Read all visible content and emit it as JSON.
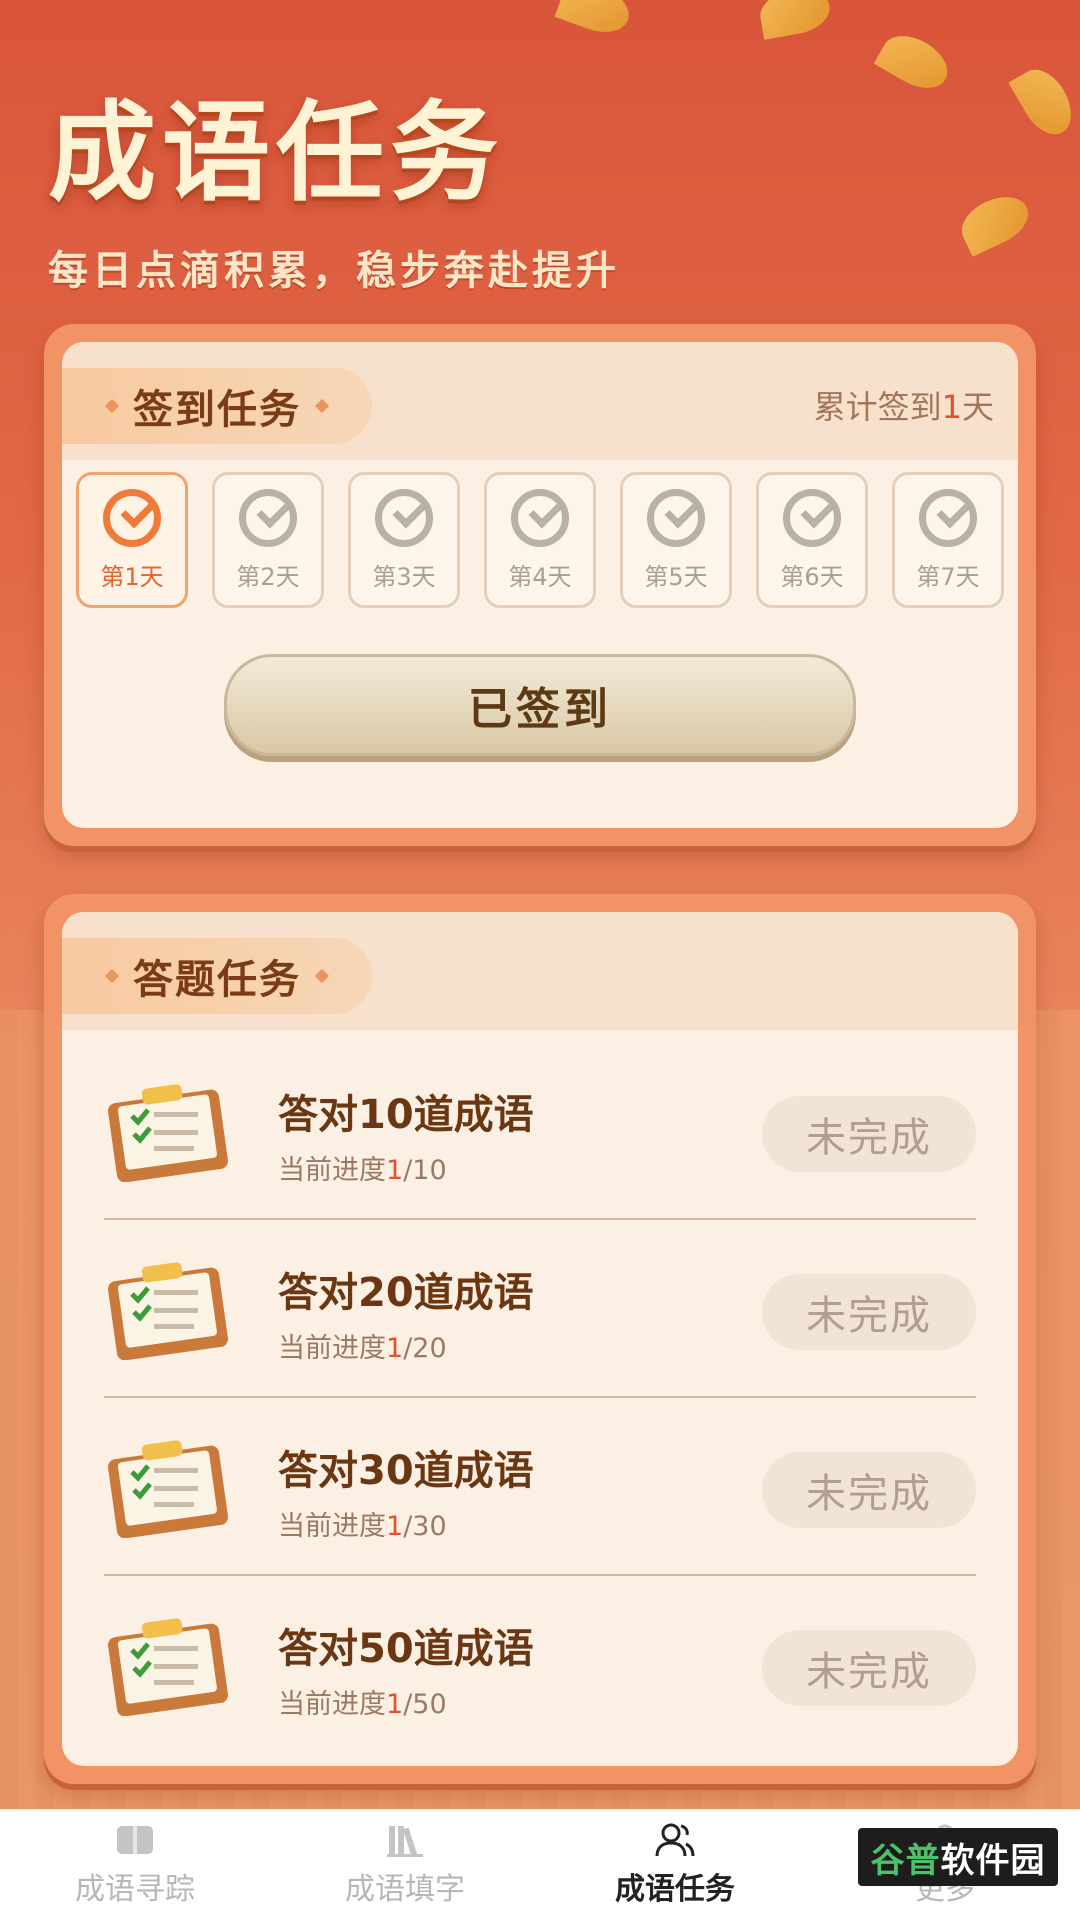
{
  "header": {
    "title": "成语任务",
    "subtitle": "每日点滴积累，稳步奔赴提升"
  },
  "signin": {
    "tag": "签到任务",
    "count_prefix": "累计签到",
    "count_value": "1",
    "count_suffix": "天",
    "days": [
      {
        "label": "第1天",
        "signed": true
      },
      {
        "label": "第2天",
        "signed": false
      },
      {
        "label": "第3天",
        "signed": false
      },
      {
        "label": "第4天",
        "signed": false
      },
      {
        "label": "第5天",
        "signed": false
      },
      {
        "label": "第6天",
        "signed": false
      },
      {
        "label": "第7天",
        "signed": false
      }
    ],
    "button_label": "已签到"
  },
  "quiz": {
    "tag": "答题任务",
    "progress_prefix": "当前进度",
    "tasks": [
      {
        "title": "答对10道成语",
        "done": "1",
        "total": "/10",
        "status": "未完成"
      },
      {
        "title": "答对20道成语",
        "done": "1",
        "total": "/20",
        "status": "未完成"
      },
      {
        "title": "答对30道成语",
        "done": "1",
        "total": "/30",
        "status": "未完成"
      },
      {
        "title": "答对50道成语",
        "done": "1",
        "total": "/50",
        "status": "未完成"
      }
    ]
  },
  "nav": {
    "items": [
      {
        "label": "成语寻踪",
        "icon": "book-icon",
        "active": false
      },
      {
        "label": "成语填字",
        "icon": "books-icon",
        "active": false
      },
      {
        "label": "成语任务",
        "icon": "users-icon",
        "active": true
      },
      {
        "label": "更多",
        "icon": "more-icon",
        "active": false
      }
    ]
  },
  "watermark": {
    "part1": "谷普",
    "part2": "软件园"
  },
  "colors": {
    "accent": "#e2502e",
    "card": "#f29366",
    "background": "#d9553a"
  }
}
